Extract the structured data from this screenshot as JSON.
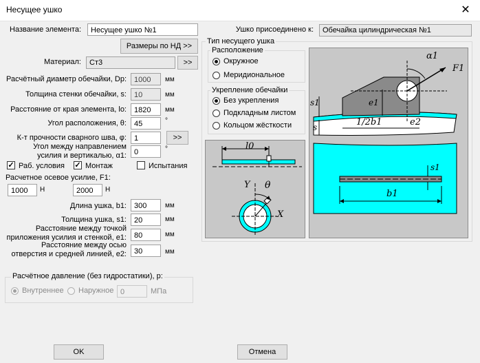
{
  "window": {
    "title": "Несущее ушко",
    "close_glyph": "✕"
  },
  "left": {
    "name_label": "Название элемента:",
    "name_value": "Несущее ушко №1",
    "sizes_button": "Размеры по НД >>",
    "material_label": "Материал:",
    "material_value": "Ст3",
    "material_button": ">>",
    "dp_label": "Расчётный диаметр обечайки, Dp:",
    "dp_value": "1000",
    "dp_unit": "мм",
    "s_label": "Толщина стенки обечайки, s:",
    "s_value": "10",
    "s_unit": "мм",
    "lo_label": "Расстояние от края элемента, lo:",
    "lo_value": "1820",
    "lo_unit": "мм",
    "theta_label": "Угол расположения, θ:",
    "theta_value": "45",
    "theta_unit": "°",
    "phi_label": "К-т прочности сварного шва, φ:",
    "phi_value": "1",
    "phi_button": ">>",
    "alpha_label_1": "Угол между направлением",
    "alpha_label_2": "усилия и вертикалью, α1:",
    "alpha_value": "0",
    "alpha_unit": "°",
    "chk_work": "Раб. условия",
    "chk_mount": "Монтаж",
    "chk_test": "Испытания",
    "f1_label": "Расчетное осевое усилие, F1:",
    "f1_value_1": "1000",
    "f1_unit_1": "Н",
    "f1_value_2": "2000",
    "f1_unit_2": "Н",
    "b1_label": "Длина ушка, b1:",
    "b1_value": "300",
    "b1_unit": "мм",
    "s1_label": "Толщина ушка, s1:",
    "s1_value": "20",
    "s1_unit": "мм",
    "e1_label_1": "Расстояние между точкой",
    "e1_label_2": "приложения усилия и стенкой, e1:",
    "e1_value": "80",
    "e1_unit": "мм",
    "e2_label_1": "Расстояние между осью",
    "e2_label_2": "отверстия и средней линией, e2:",
    "e2_value": "30",
    "e2_unit": "мм"
  },
  "pressure": {
    "title": "Расчётное давление (без гидростатики), р:",
    "internal": "Внутреннее",
    "external": "Наружное",
    "value": "0",
    "unit": "МПа"
  },
  "right": {
    "attached_label": "Ушко присоединено к:",
    "attached_value": "Обечайка цилиндрическая №1",
    "type_group": "Тип несущего ушка",
    "placement_group": "Расположение",
    "placement_options": [
      "Окружное",
      "Меридиональное"
    ],
    "reinforce_group": "Укрепление обечайки",
    "reinforce_options": [
      "Без укрепления",
      "Подкладным листом",
      "Кольцом жёсткости"
    ]
  },
  "sketch": {
    "label_lo": "l0",
    "label_y": "Y",
    "label_x": "X",
    "label_theta": "θ",
    "label_alpha": "α1",
    "label_f": "F1",
    "label_s1": "s1",
    "label_e1": "e1",
    "label_s": "s",
    "label_halfb1": "1/2b1",
    "label_e2": "e2",
    "label_b1": "b1",
    "label_s1b": "s1",
    "accent_cyan": "#00ffff"
  },
  "buttons": {
    "ok": "OK",
    "cancel": "Отмена"
  }
}
